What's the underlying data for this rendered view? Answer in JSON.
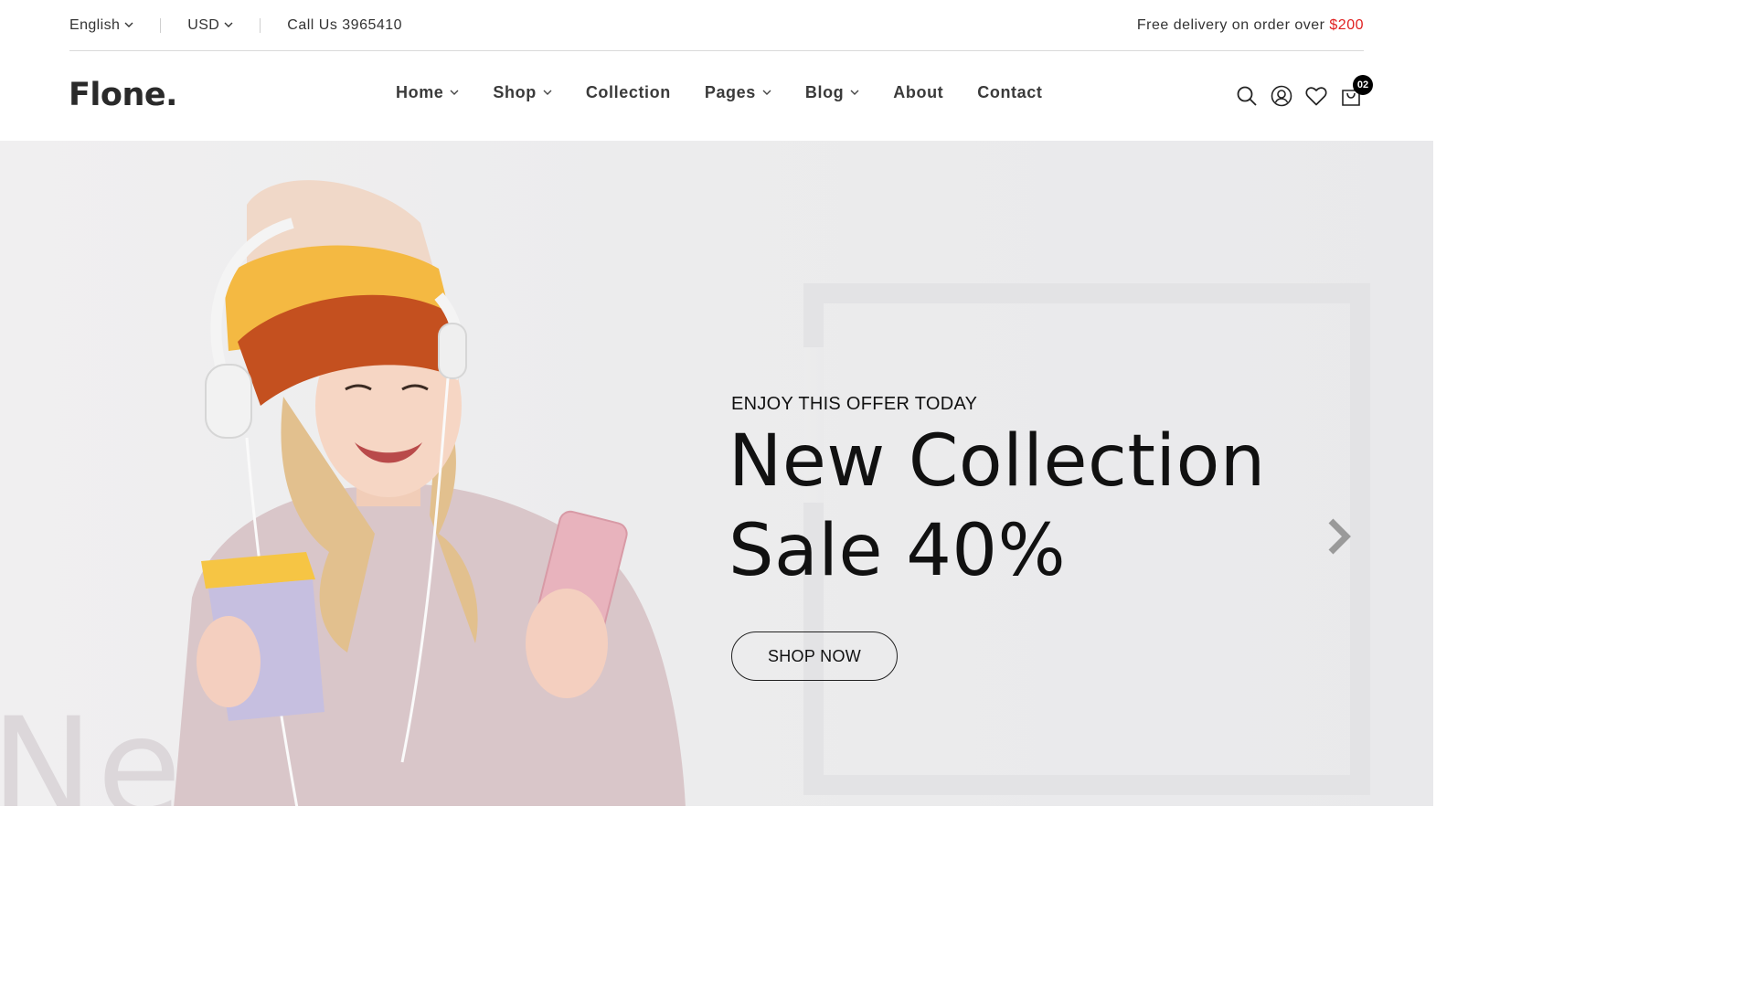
{
  "topbar": {
    "language": "English",
    "currency": "USD",
    "call": "Call Us 3965410",
    "free_delivery": "Free delivery on order over ",
    "free_delivery_amount": "$200"
  },
  "header": {
    "logo": "Flone.",
    "nav": [
      {
        "label": "Home",
        "dropdown": true
      },
      {
        "label": "Shop",
        "dropdown": true
      },
      {
        "label": "Collection",
        "dropdown": false
      },
      {
        "label": "Pages",
        "dropdown": true
      },
      {
        "label": "Blog",
        "dropdown": true
      },
      {
        "label": "About",
        "dropdown": false
      },
      {
        "label": "Contact",
        "dropdown": false
      }
    ],
    "icons": [
      "search-icon",
      "account-icon",
      "heart-icon",
      "cart-icon"
    ],
    "cart_count": "02"
  },
  "hero": {
    "subtitle": "ENJOY THIS OFFER TODAY",
    "title_line1": "New Collection",
    "title_line2": "Sale 40%",
    "button": "SHOP NOW",
    "ghost_text": "New Sale"
  },
  "colors": {
    "accent_price": "#e02020",
    "text_dark": "#111111",
    "hero_bg": "#ececed"
  }
}
